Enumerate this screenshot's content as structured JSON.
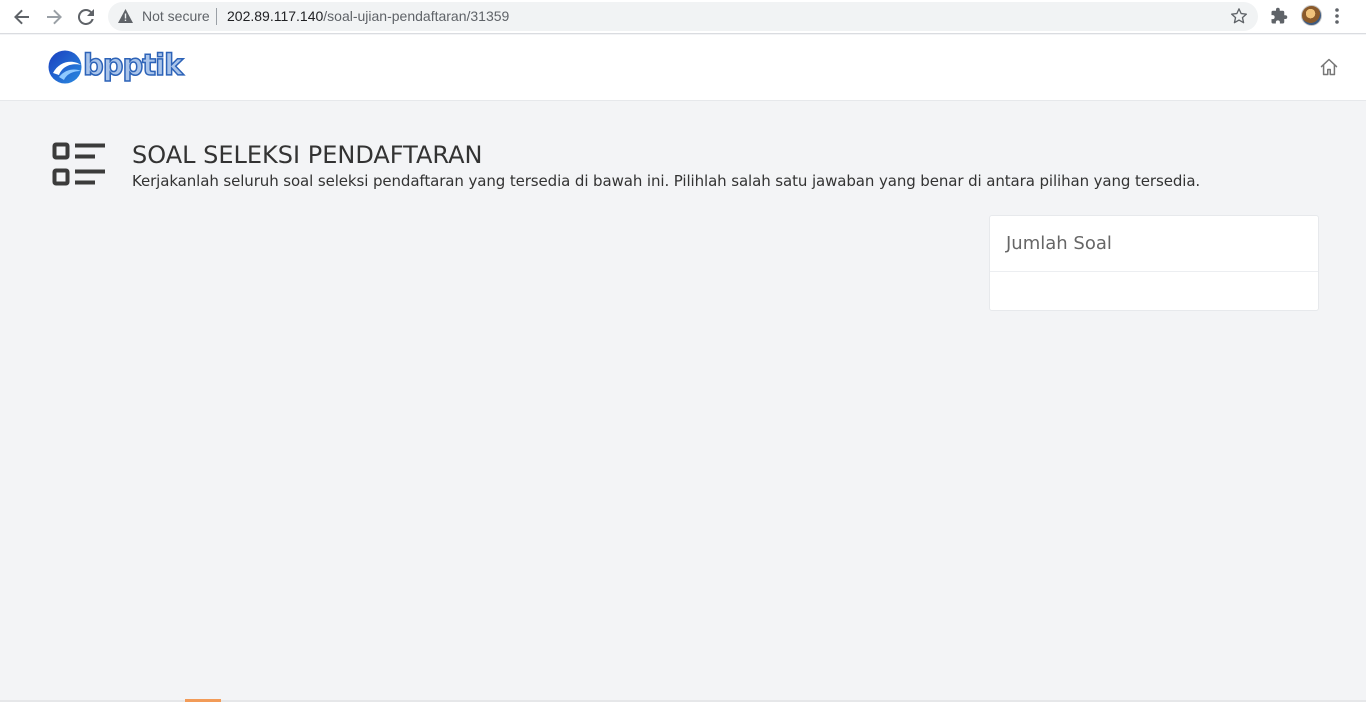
{
  "browser": {
    "security_label": "Not secure",
    "url_host": "202.89.117.140",
    "url_path": "/soal-ujian-pendaftaran/31359"
  },
  "site": {
    "logo_text": "bpptik",
    "brand_color": "#2d63b8"
  },
  "main": {
    "title": "SOAL SELEKSI PENDAFTARAN",
    "subtitle": "Kerjakanlah seluruh soal seleksi pendaftaran yang tersedia di bawah ini. Pilihlah salah satu jawaban yang benar di antara pilihan yang tersedia."
  },
  "sidebar_card": {
    "title": "Jumlah Soal"
  },
  "icons": {
    "back": "arrow-left-icon",
    "forward": "arrow-right-icon",
    "reload": "reload-icon",
    "warning": "warning-icon",
    "bookmark": "star-icon",
    "extensions": "puzzle-icon",
    "menu": "kebab-menu-icon",
    "home": "home-icon",
    "section": "list-icon"
  }
}
